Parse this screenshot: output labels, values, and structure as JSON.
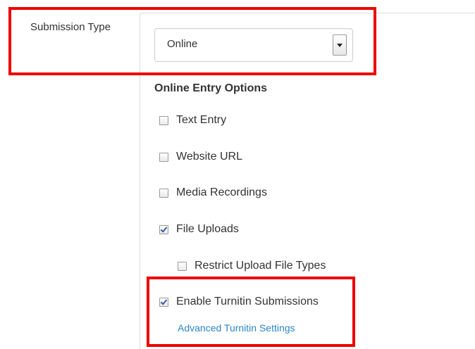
{
  "submission_type": {
    "label": "Submission Type",
    "selected": "Online"
  },
  "online_entry": {
    "heading": "Online Entry Options",
    "options": [
      {
        "label": "Text Entry",
        "checked": false
      },
      {
        "label": "Website URL",
        "checked": false
      },
      {
        "label": "Media Recordings",
        "checked": false
      },
      {
        "label": "File Uploads",
        "checked": true
      },
      {
        "label": "Restrict Upload File Types",
        "checked": false
      },
      {
        "label": "Enable Turnitin Submissions",
        "checked": true
      }
    ]
  },
  "turnitin": {
    "link": "Advanced Turnitin Settings"
  },
  "colors": {
    "highlight": "#ee0000",
    "link": "#2a87c7"
  }
}
